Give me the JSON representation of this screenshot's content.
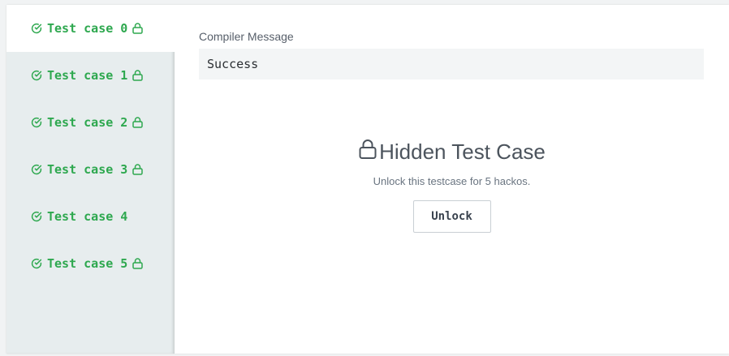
{
  "sidebar": {
    "tabs": [
      {
        "label": "Test case 0",
        "locked": true,
        "active": true
      },
      {
        "label": "Test case 1",
        "locked": true,
        "active": false
      },
      {
        "label": "Test case 2",
        "locked": true,
        "active": false
      },
      {
        "label": "Test case 3",
        "locked": true,
        "active": false
      },
      {
        "label": "Test case 4",
        "locked": false,
        "active": false
      },
      {
        "label": "Test case 5",
        "locked": true,
        "active": false
      }
    ]
  },
  "main": {
    "compiler_label": "Compiler Message",
    "compiler_message": "Success",
    "hidden_title": "Hidden Test Case",
    "hidden_subtitle": "Unlock this testcase for 5 hackos.",
    "unlock_label": "Unlock"
  },
  "colors": {
    "success_green": "#2ea84f",
    "sidebar_bg": "#e7edee",
    "text_dark": "#39424e"
  },
  "icons": {
    "tab_status": "check-circle-icon",
    "tab_lock": "lock-icon",
    "hidden_lock": "lock-icon"
  }
}
